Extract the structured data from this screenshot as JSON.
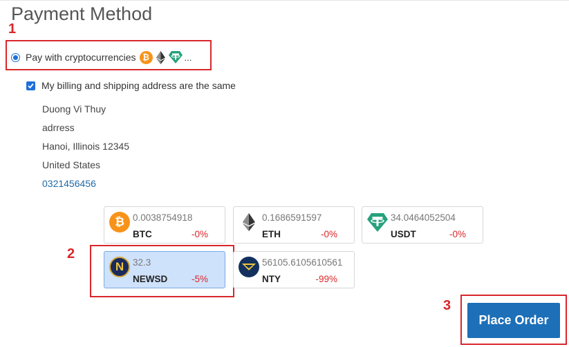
{
  "section_title": "Payment Method",
  "annotations": [
    "1",
    "2",
    "3"
  ],
  "payment_option": {
    "label": "Pay with cryptocurrencies",
    "selected": true,
    "more": "...",
    "icons": [
      "bitcoin-icon",
      "ethereum-icon",
      "tether-icon"
    ]
  },
  "billing_same": {
    "label": "My billing and shipping address are the same",
    "checked": true
  },
  "address": {
    "name": "Duong Vi Thuy",
    "street": "adrress",
    "city_line": "Hanoi, Illinois 12345",
    "country": "United States",
    "phone": "0321456456"
  },
  "coins": [
    {
      "symbol": "BTC",
      "amount": "0.0038754918",
      "change": "-0%",
      "icon": "bitcoin-icon",
      "color": "#f7931a",
      "selected": false
    },
    {
      "symbol": "ETH",
      "amount": "0.1686591597",
      "change": "-0%",
      "icon": "ethereum-icon",
      "color": "#3c3c3d",
      "selected": false
    },
    {
      "symbol": "USDT",
      "amount": "34.0464052504",
      "change": "-0%",
      "icon": "tether-icon",
      "color": "#26a17b",
      "selected": false
    },
    {
      "symbol": "NEWSD",
      "amount": "32.3",
      "change": "-5%",
      "icon": "newsd-icon",
      "color": "#1a2a5c",
      "selected": true
    },
    {
      "symbol": "NTY",
      "amount": "56105.6105610561",
      "change": "-99%",
      "icon": "nty-icon",
      "color": "#13305e",
      "selected": false
    }
  ],
  "place_order_label": "Place Order",
  "colors": {
    "accent": "#1d6fb8",
    "annotation_red": "#d9262a",
    "negative_change": "#d9262a",
    "selected_card_bg": "#cfe2fb"
  }
}
